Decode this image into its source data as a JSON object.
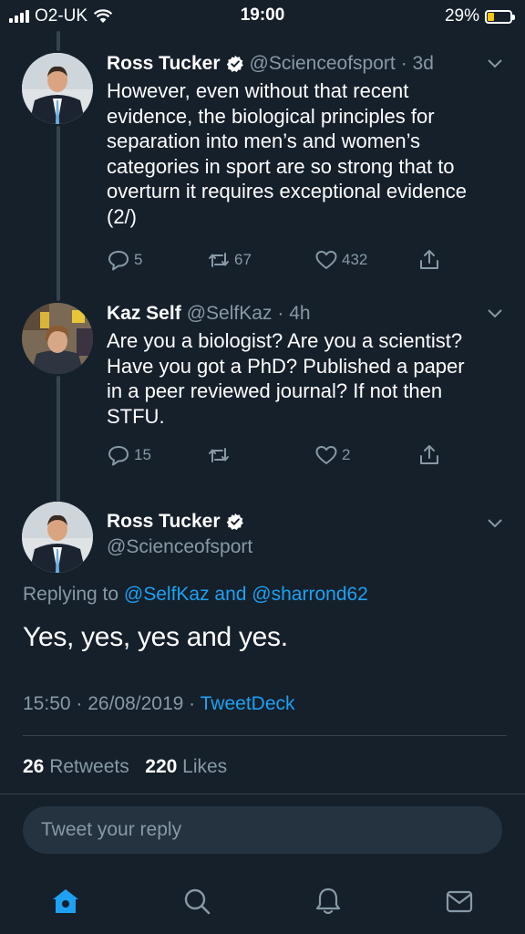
{
  "status_bar": {
    "carrier": "O2-UK",
    "time": "19:00",
    "battery_percent": "29%",
    "battery_level": 0.29,
    "battery_color": "#f5c518"
  },
  "tweets": [
    {
      "name": "Ross Tucker",
      "handle": "@Scienceofsport",
      "time": "· 3d",
      "verified": true,
      "text_lines": [
        "However, even without that recent",
        "evidence, the biological principles for",
        "separation into men’s and women’s",
        "categories in sport are so strong that to",
        "overturn it requires exceptional evidence",
        "(2/)"
      ],
      "replies": "5",
      "retweets": "67",
      "likes": "432"
    },
    {
      "name": "Kaz Self",
      "handle": "@SelfKaz",
      "time": "· 4h",
      "verified": false,
      "text_lines": [
        "Are you a biologist? Are you a scientist?",
        "Have you got a PhD? Published a paper",
        "in a peer reviewed journal? If not then",
        "STFU."
      ],
      "replies": "15",
      "retweets": "",
      "likes": "2"
    }
  ],
  "main_tweet": {
    "name": "Ross Tucker",
    "handle": "@Scienceofsport",
    "replying_prefix": "Replying to",
    "replying_to": "@SelfKaz and @sharrond62",
    "text": "Yes, yes, yes and yes.",
    "timestamp": "15:50 · 26/08/2019 ·",
    "client": "TweetDeck",
    "retweet_count": "26",
    "retweet_label": "Retweets",
    "like_count": "220",
    "like_label": "Likes"
  },
  "reply": {
    "placeholder": "Tweet your reply"
  },
  "tabbar": {
    "items": [
      "home-icon",
      "search-icon",
      "bell-icon",
      "mail-icon"
    ],
    "active": "home-icon",
    "accent": "#1da1f2"
  },
  "colors": {
    "background": "#15202b",
    "secondary_text": "#8899a6",
    "link": "#1da1f2"
  }
}
